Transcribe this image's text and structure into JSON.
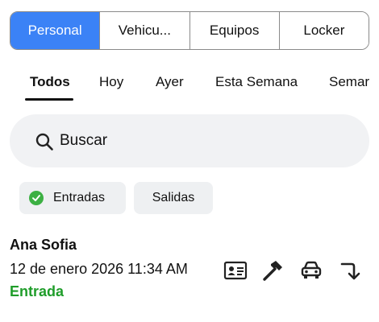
{
  "segments": [
    {
      "label": "Personal",
      "active": true
    },
    {
      "label": "Vehicu...",
      "active": false
    },
    {
      "label": "Equipos",
      "active": false
    },
    {
      "label": "Locker",
      "active": false
    }
  ],
  "tabs": [
    {
      "label": "Todos",
      "active": true
    },
    {
      "label": "Hoy",
      "active": false
    },
    {
      "label": "Ayer",
      "active": false
    },
    {
      "label": "Esta Semana",
      "active": false
    },
    {
      "label": "Semar",
      "active": false
    }
  ],
  "search": {
    "placeholder": "Buscar",
    "icon": "search-icon"
  },
  "chips": {
    "entradas": {
      "label": "Entradas",
      "selected": true
    },
    "salidas": {
      "label": "Salidas",
      "selected": false
    }
  },
  "record": {
    "name": "Ana Sofia",
    "datetime": "12 de enero 2026 11:34 AM",
    "status": "Entrada",
    "actions": [
      "id-card-icon",
      "hammer-icon",
      "car-icon",
      "turn-down-arrow-icon"
    ]
  },
  "colors": {
    "accent": "#3b82f6",
    "status_green": "#1f9d2a",
    "check_green": "#3cb043",
    "search_bg": "#f1f2f4"
  }
}
